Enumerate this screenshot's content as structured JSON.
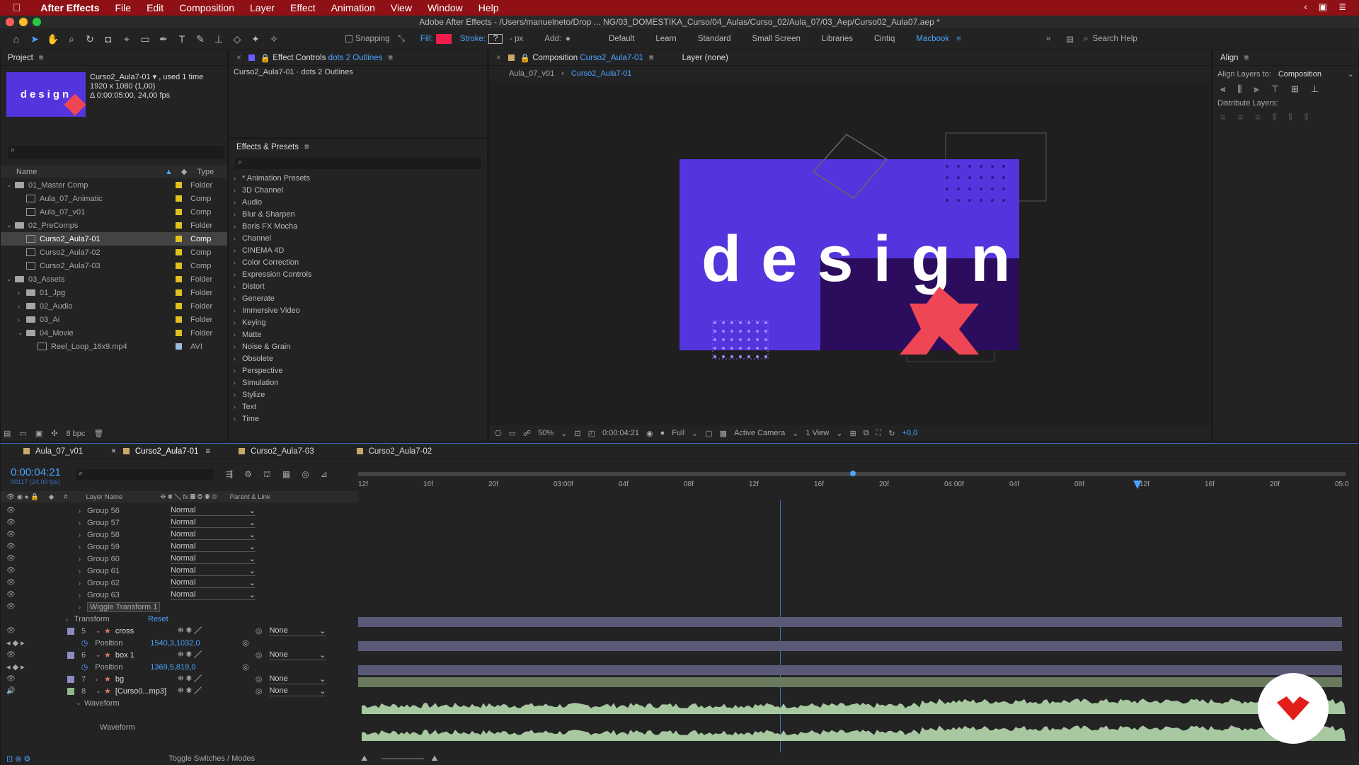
{
  "menubar": {
    "app": "After Effects",
    "items": [
      "File",
      "Edit",
      "Composition",
      "Layer",
      "Effect",
      "Animation",
      "View",
      "Window",
      "Help"
    ]
  },
  "window": {
    "title": "Adobe After Effects - /Users/manuelneto/Drop ... NG/03_DOMESTIKA_Curso/04_Aulas/Curso_02/Aula_07/03_Aep/Curso02_Aula07.aep *"
  },
  "toolbar": {
    "snapping": "Snapping",
    "fill": "Fill:",
    "stroke": "Stroke:",
    "stroke_val": "?",
    "px": "- px",
    "add": "Add:",
    "workspaces": [
      "Default",
      "Learn",
      "Standard",
      "Small Screen",
      "Libraries",
      "Cintiq",
      "Macbook"
    ],
    "search_help": "Search Help"
  },
  "project": {
    "tab": "Project",
    "comp_name": "Curso2_Aula7-01 ▾ , used 1 time",
    "comp_dims": "1920 x 1080 (1,00)",
    "comp_dur": "Δ 0:00:05:00, 24,00 fps",
    "col_name": "Name",
    "col_type": "Type",
    "items": [
      {
        "name": "01_Master Comp",
        "type": "Folder",
        "kind": "folder",
        "indent": 0,
        "open": true
      },
      {
        "name": "Aula_07_Animatic",
        "type": "Comp",
        "kind": "comp",
        "indent": 1
      },
      {
        "name": "Aula_07_v01",
        "type": "Comp",
        "kind": "comp",
        "indent": 1
      },
      {
        "name": "02_PreComps",
        "type": "Folder",
        "kind": "folder",
        "indent": 0,
        "open": true
      },
      {
        "name": "Curso2_Aula7-01",
        "type": "Comp",
        "kind": "comp",
        "indent": 1,
        "selected": true
      },
      {
        "name": "Curso2_Aula7-02",
        "type": "Comp",
        "kind": "comp",
        "indent": 1
      },
      {
        "name": "Curso2_Aula7-03",
        "type": "Comp",
        "kind": "comp",
        "indent": 1
      },
      {
        "name": "03_Assets",
        "type": "Folder",
        "kind": "folder",
        "indent": 0,
        "open": true
      },
      {
        "name": "01_Jpg",
        "type": "Folder",
        "kind": "folder",
        "indent": 1
      },
      {
        "name": "02_Audio",
        "type": "Folder",
        "kind": "folder",
        "indent": 1
      },
      {
        "name": "03_Ai",
        "type": "Folder",
        "kind": "folder",
        "indent": 1
      },
      {
        "name": "04_Movie",
        "type": "Folder",
        "kind": "folder",
        "indent": 1,
        "open": true
      },
      {
        "name": "Reel_Loop_16x9.mp4",
        "type": "AVI",
        "kind": "file",
        "indent": 2
      }
    ],
    "bpc": "8 bpc"
  },
  "effect_controls": {
    "tab": "Effect Controls",
    "tab_target": "dots 2 Outlines",
    "subtitle": "Curso2_Aula7-01 · dots 2 Outlines"
  },
  "effects_presets": {
    "tab": "Effects & Presets",
    "items": [
      "* Animation Presets",
      "3D Channel",
      "Audio",
      "Blur & Sharpen",
      "Boris FX Mocha",
      "Channel",
      "CINEMA 4D",
      "Color Correction",
      "Expression Controls",
      "Distort",
      "Generate",
      "Immersive Video",
      "Keying",
      "Matte",
      "Noise & Grain",
      "Obsolete",
      "Perspective",
      "Simulation",
      "Stylize",
      "Text",
      "Time"
    ]
  },
  "composition": {
    "tab": "Composition",
    "tab_target": "Curso2_Aula7-01",
    "layer_tab": "Layer (none)",
    "crumbs": [
      "Aula_07_v01",
      "Curso2_Aula7-01"
    ],
    "word": "design",
    "zoom": "50%",
    "timecode": "0:00:04:21",
    "res": "Full",
    "camera": "Active Camera",
    "view": "1 View",
    "exposure": "+0,0"
  },
  "align": {
    "tab": "Align",
    "align_to_label": "Align Layers to:",
    "align_to": "Composition",
    "distribute": "Distribute Layers:"
  },
  "timeline": {
    "tabs": [
      "Aula_07_v01",
      "Curso2_Aula7-01",
      "Curso2_Aula7-03",
      "Curso2_Aula7-02"
    ],
    "timecode": "0:00:04:21",
    "fps": "00117 (24.00 fps)",
    "col_layer": "Layer Name",
    "col_parent": "Parent & Link",
    "ruler": [
      "12f",
      "16f",
      "20f",
      "03:00f",
      "04f",
      "08f",
      "12f",
      "16f",
      "20f",
      "04:00f",
      "04f",
      "08f",
      "12f",
      "16f",
      "20f",
      "05:0"
    ],
    "groups": [
      "Group 56",
      "Group 57",
      "Group 58",
      "Group 59",
      "Group 60",
      "Group 61",
      "Group 62",
      "Group 63"
    ],
    "mode": "Normal",
    "wiggle": "Wiggle Transform 1",
    "transform": "Transform",
    "reset": "Reset",
    "layers": [
      {
        "num": "5",
        "name": "cross",
        "parent": "None",
        "prop": "Position",
        "val": "1540,3,1032,0"
      },
      {
        "num": "6",
        "name": "box 1",
        "parent": "None",
        "prop": "Position",
        "val": "1369,5,819,0"
      },
      {
        "num": "7",
        "name": "bg",
        "parent": "None"
      },
      {
        "num": "8",
        "name": "[Curso0...mp3]",
        "parent": "None"
      }
    ],
    "waveform": "Waveform",
    "toggle": "Toggle Switches / Modes"
  },
  "colors": {
    "accent": "#4aa3ff",
    "purple": "#5435dd",
    "dark_purple": "#2c0c5c",
    "coral": "#ef4655",
    "menubar": "#8f1015"
  }
}
